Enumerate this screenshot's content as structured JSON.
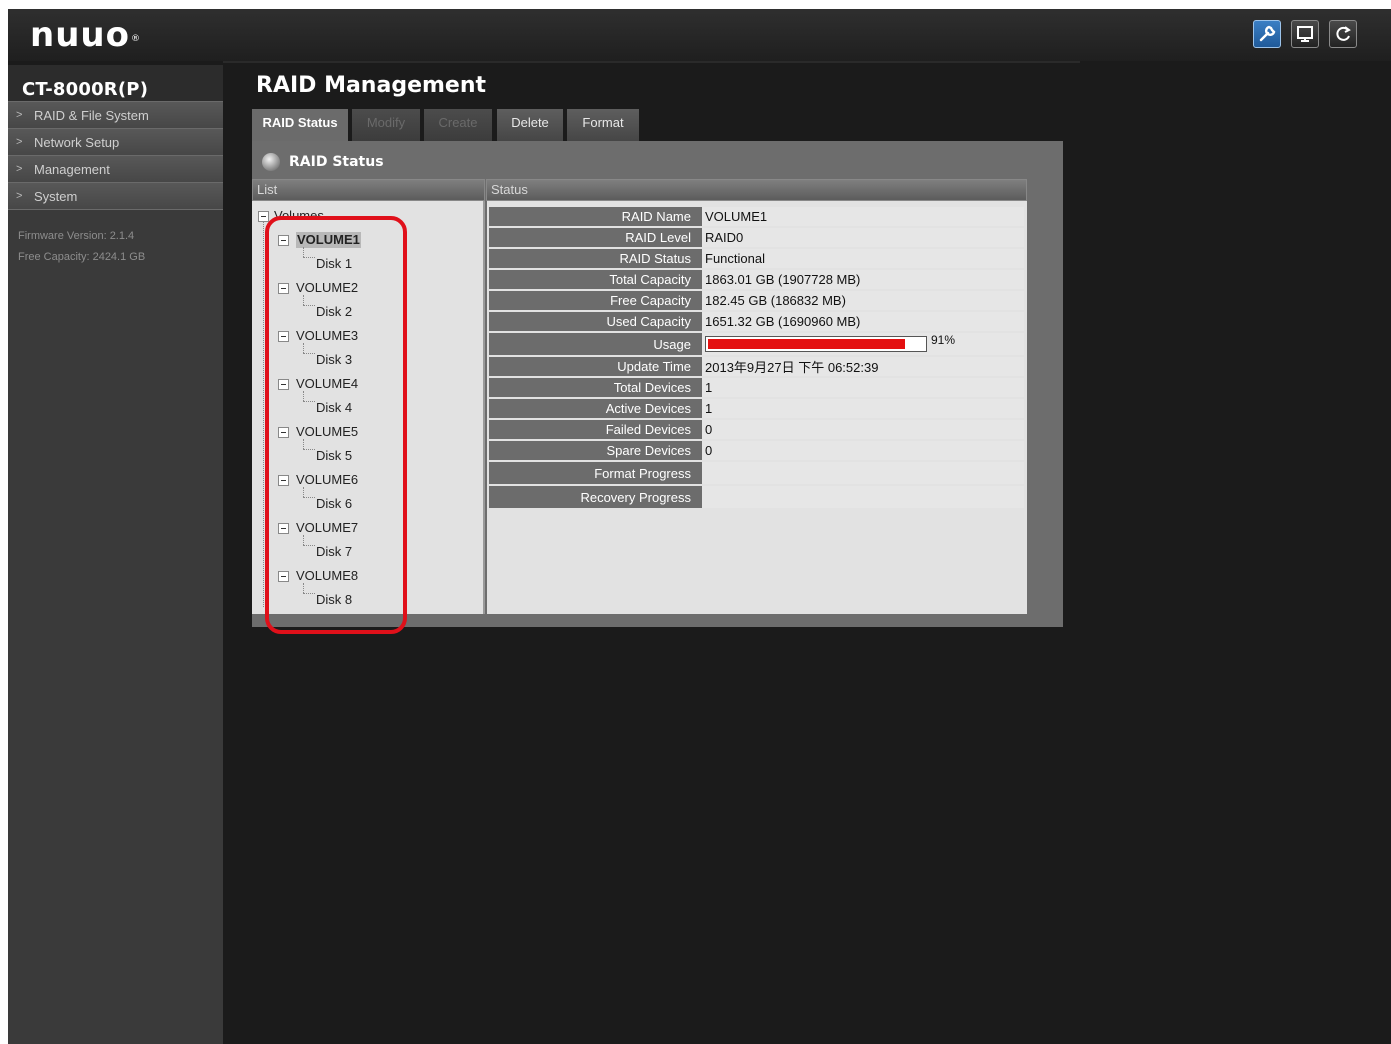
{
  "brand": {
    "logo_text": "nuuo",
    "registered_mark": "®"
  },
  "top_buttons": [
    {
      "icon": "wrench-icon",
      "active": true
    },
    {
      "icon": "monitor-icon",
      "active": false
    },
    {
      "icon": "logout-icon",
      "active": false
    }
  ],
  "sidebar": {
    "device_name": "CT-8000R(P)",
    "items": [
      {
        "label": "RAID & File System"
      },
      {
        "label": "Network Setup"
      },
      {
        "label": "Management"
      },
      {
        "label": "System"
      }
    ],
    "firmware": "Firmware Version: 2.1.4",
    "free_capacity": "Free Capacity: 2424.1 GB"
  },
  "page_title": "RAID Management",
  "tabs": [
    {
      "label": "RAID Status",
      "state": "active"
    },
    {
      "label": "Modify",
      "state": "disabled"
    },
    {
      "label": "Create",
      "state": "disabled"
    },
    {
      "label": "Delete",
      "state": "normal"
    },
    {
      "label": "Format",
      "state": "normal"
    }
  ],
  "panel": {
    "title": "RAID Status",
    "list_header": "List",
    "status_header": "Status"
  },
  "tree": {
    "root": "Volumes",
    "volumes": [
      {
        "name": "VOLUME1",
        "disk": "Disk 1",
        "selected": true
      },
      {
        "name": "VOLUME2",
        "disk": "Disk 2"
      },
      {
        "name": "VOLUME3",
        "disk": "Disk 3"
      },
      {
        "name": "VOLUME4",
        "disk": "Disk 4"
      },
      {
        "name": "VOLUME5",
        "disk": "Disk 5"
      },
      {
        "name": "VOLUME6",
        "disk": "Disk 6"
      },
      {
        "name": "VOLUME7",
        "disk": "Disk 7"
      },
      {
        "name": "VOLUME8",
        "disk": "Disk 8"
      }
    ]
  },
  "status": {
    "raid_name": {
      "label": "RAID Name",
      "value": "VOLUME1"
    },
    "raid_level": {
      "label": "RAID Level",
      "value": "RAID0"
    },
    "raid_status": {
      "label": "RAID Status",
      "value": "Functional"
    },
    "total_capacity": {
      "label": "Total Capacity",
      "value": "1863.01 GB (1907728 MB)"
    },
    "free_capacity": {
      "label": "Free Capacity",
      "value": "182.45 GB (186832 MB)"
    },
    "used_capacity": {
      "label": "Used Capacity",
      "value": "1651.32 GB (1690960 MB)"
    },
    "usage": {
      "label": "Usage",
      "percent": 91,
      "text": "91%"
    },
    "update_time": {
      "label": "Update Time",
      "value": "2013年9月27日 下午 06:52:39"
    },
    "total_devices": {
      "label": "Total Devices",
      "value": "1"
    },
    "active_devices": {
      "label": "Active Devices",
      "value": "1"
    },
    "failed_devices": {
      "label": "Failed Devices",
      "value": "0"
    },
    "spare_devices": {
      "label": "Spare Devices",
      "value": "0"
    },
    "format_progress": {
      "label": "Format Progress",
      "value": ""
    },
    "recovery_progress": {
      "label": "Recovery Progress",
      "value": ""
    }
  },
  "colors": {
    "usage_fill": "#e41010",
    "highlight": "#e0101a"
  }
}
